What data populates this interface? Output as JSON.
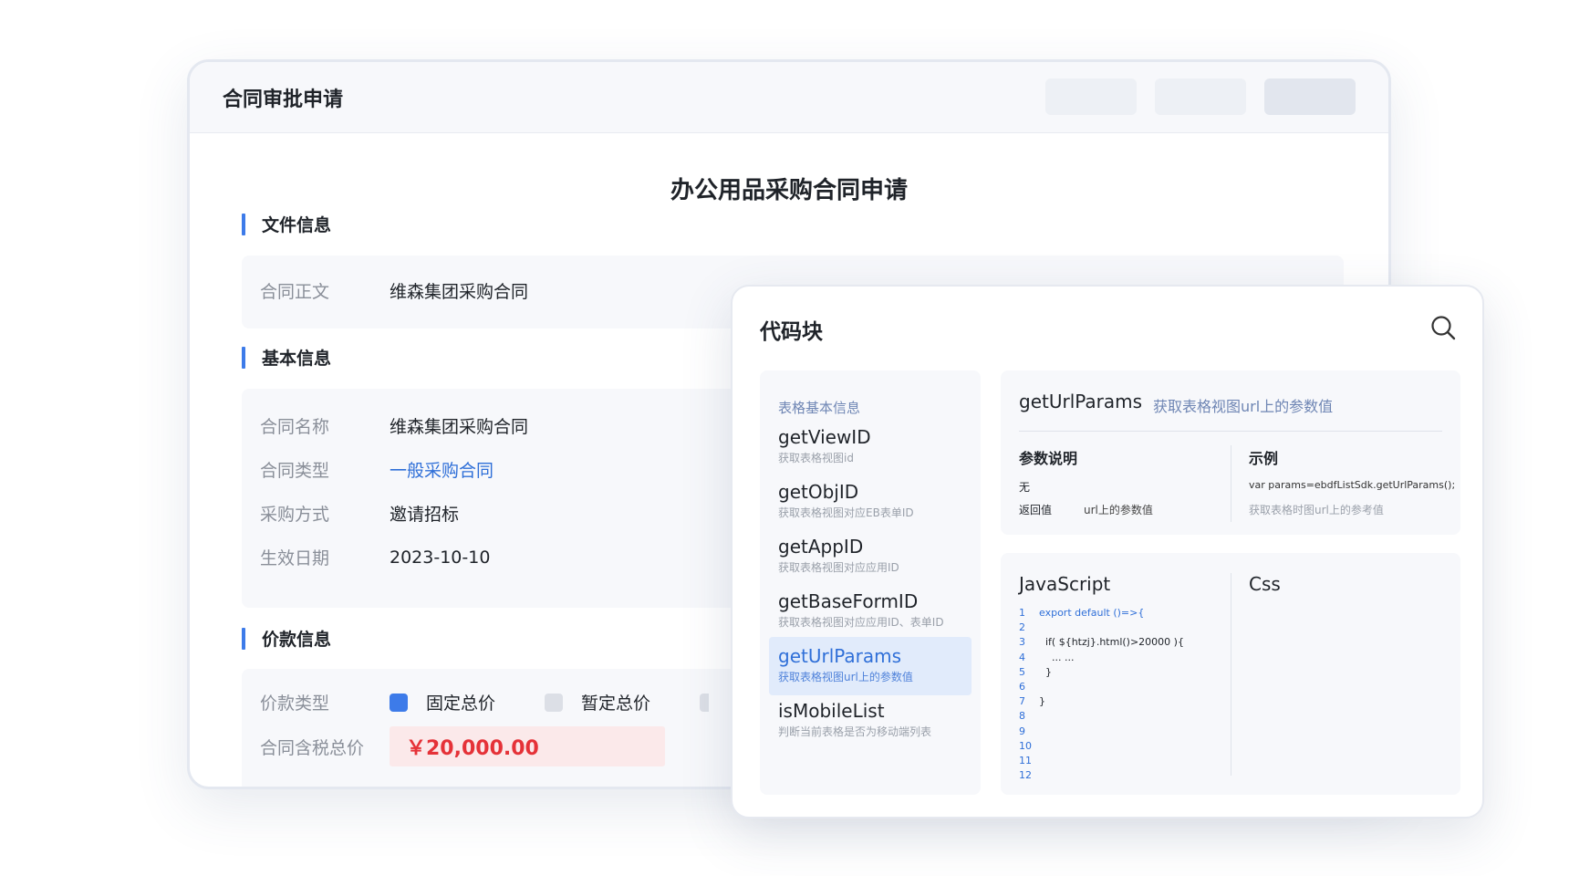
{
  "contract_window": {
    "title": "合同审批申请",
    "doc_title": "办公用品采购合同申请",
    "sections": {
      "file_info": {
        "heading": "文件信息",
        "contract_text_label": "合同正文",
        "contract_text_value": "维森集团采购合同"
      },
      "basic_info": {
        "heading": "基本信息",
        "rows": [
          {
            "label": "合同名称",
            "value": "维森集团采购合同"
          },
          {
            "label": "合同类型",
            "value": "一般采购合同"
          },
          {
            "label": "采购方式",
            "value": "邀请招标"
          },
          {
            "label": "生效日期",
            "value": "2023-10-10"
          }
        ]
      },
      "price_info": {
        "heading": "价款信息",
        "price_type_label": "价款类型",
        "options": [
          "固定总价",
          "暂定总价"
        ],
        "selected_option": "固定总价",
        "total_label": "合同含税总价",
        "total_value": "￥20,000.00"
      }
    }
  },
  "code_window": {
    "title": "代码块",
    "category": "表格基本信息",
    "items": [
      {
        "name": "getViewID",
        "desc": "获取表格视图id"
      },
      {
        "name": "getObjID",
        "desc": "获取表格视图对应EB表单ID"
      },
      {
        "name": "getAppID",
        "desc": "获取表格视图对应应用ID"
      },
      {
        "name": "getBaseFormID",
        "desc": "获取表格视图对应应用ID、表单ID"
      },
      {
        "name": "getUrlParams",
        "desc": "获取表格视图url上的参数值"
      },
      {
        "name": "isMobileList",
        "desc": "判断当前表格是否为移动端列表"
      }
    ],
    "selected_item": "getUrlParams",
    "detail": {
      "function_name": "getUrlParams",
      "function_desc": "获取表格视图url上的参数值",
      "param_heading": "参数说明",
      "example_heading": "示例",
      "param_value": "无",
      "return_label": "返回值",
      "return_value": "url上的参数值",
      "example_code": "var params=ebdfListSdk.getUrlParams();",
      "example_note": "获取表格时图url上的参考值"
    },
    "code": {
      "js_label": "JavaScript",
      "css_label": "Css",
      "lines": [
        {
          "num": "1",
          "text": "export default ()=>{"
        },
        {
          "num": "2",
          "text": ""
        },
        {
          "num": "3",
          "text": "  if( ${htzj}.html()>20000 ){"
        },
        {
          "num": "4",
          "text": "    ... ..."
        },
        {
          "num": "5",
          "text": "  }"
        },
        {
          "num": "6",
          "text": ""
        },
        {
          "num": "7",
          "text": "}"
        },
        {
          "num": "8",
          "text": ""
        },
        {
          "num": "9",
          "text": ""
        },
        {
          "num": "10",
          "text": ""
        },
        {
          "num": "11",
          "text": ""
        },
        {
          "num": "12",
          "text": ""
        }
      ]
    }
  },
  "colors": {
    "accent": "#3d7be9",
    "link": "#2f6fd8",
    "price_red": "#e53238",
    "panel_bg": "#f7f8fb"
  }
}
